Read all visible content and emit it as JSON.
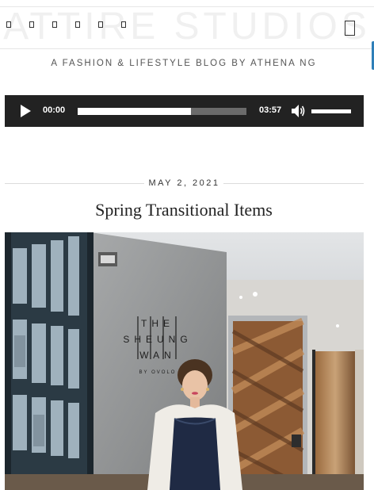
{
  "header": {
    "site_title": "ATTIRE STUDIOS",
    "tagline": "A FASHION & LIFESTYLE BLOG BY ATHENA NG",
    "social_icons": [
      "social-icon-1",
      "social-icon-2",
      "social-icon-3",
      "social-icon-4",
      "social-icon-5",
      "social-icon-6"
    ],
    "menu_icon": "menu-icon"
  },
  "audio_player": {
    "current_time": "00:00",
    "duration": "03:57",
    "progress": 0.67,
    "volume": 1.0,
    "play_icon": "play-icon",
    "volume_icon": "volume-icon"
  },
  "post": {
    "date": "MAY 2, 2021",
    "title": "Spring Transitional Items",
    "image": {
      "sign_text": [
        "THE",
        "SHEUNG",
        "WAN",
        "BY OVOLO"
      ]
    }
  },
  "colors": {
    "player_bg": "#222222",
    "accent_tab": "#2f7fb8",
    "divider": "#dcdcdc"
  }
}
